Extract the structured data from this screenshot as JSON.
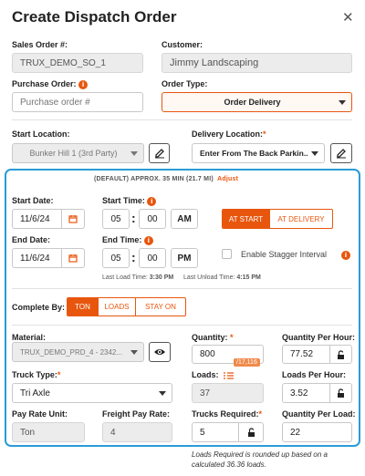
{
  "dialog": {
    "title": "Create Dispatch Order",
    "close": "✕"
  },
  "sales_order": {
    "label": "Sales Order #:",
    "value": "TRUX_DEMO_SO_1"
  },
  "customer": {
    "label": "Customer:",
    "value": "Jimmy Landscaping"
  },
  "purchase_order": {
    "label": "Purchase Order:",
    "placeholder": "Purchase order #"
  },
  "order_type": {
    "label": "Order Type:",
    "value": "Order Delivery"
  },
  "start_location": {
    "label": "Start Location:",
    "value": "Bunker Hill 1 (3rd Party)"
  },
  "delivery_location": {
    "label": "Delivery Location:",
    "required": "*",
    "value": "Enter From The Back Parkin..."
  },
  "route": {
    "text": "(DEFAULT) APPROX. 35 MIN (21.7 MI)",
    "adjust": "Adjust"
  },
  "start_date": {
    "label": "Start Date:",
    "value": "11/6/24"
  },
  "start_time": {
    "label": "Start Time:",
    "hour": "05",
    "minute": "00",
    "ampm": "AM"
  },
  "timing_toggle": {
    "options": [
      "AT START",
      "AT DELIVERY"
    ],
    "selected": "AT START"
  },
  "end_date": {
    "label": "End Date:",
    "value": "11/6/24"
  },
  "end_time": {
    "label": "End Time:",
    "hour": "05",
    "minute": "00",
    "ampm": "PM"
  },
  "stagger": {
    "label": "Enable Stagger Interval"
  },
  "load_times": {
    "load_label": "Last Load Time:",
    "load_value": "3:30 PM",
    "unload_label": "Last Unload Time:",
    "unload_value": "4:15 PM"
  },
  "complete_by": {
    "label": "Complete By:",
    "options": [
      "TON",
      "LOADS",
      "STAY ON"
    ],
    "selected": "TON"
  },
  "material": {
    "label": "Material:",
    "value": "TRUX_DEMO_PRD_4 - 2342..."
  },
  "quantity": {
    "label": "Quantity:",
    "required": "*",
    "value": "800",
    "badge": "/17,116"
  },
  "quantity_per_hour": {
    "label": "Quantity Per Hour:",
    "value": "77.52"
  },
  "truck_type": {
    "label": "Truck Type:",
    "required": "*",
    "value": "Tri Axle"
  },
  "loads": {
    "label": "Loads:",
    "value": "37"
  },
  "loads_per_hour": {
    "label": "Loads Per Hour:",
    "value": "3.52"
  },
  "pay_rate_unit": {
    "label": "Pay Rate Unit:",
    "value": "Ton"
  },
  "freight_pay_rate": {
    "label": "Freight Pay Rate:",
    "value": "4"
  },
  "trucks_required": {
    "label": "Trucks Required:",
    "required": "*",
    "value": "5"
  },
  "quantity_per_load": {
    "label": "Quantity Per Load:",
    "value": "22"
  },
  "footnote": {
    "line1": "Loads Required is rounded up based on a",
    "line2": "calculated 36.36 loads."
  },
  "colors": {
    "accent": "#e8560e",
    "panel_border": "#2a9bd6"
  }
}
